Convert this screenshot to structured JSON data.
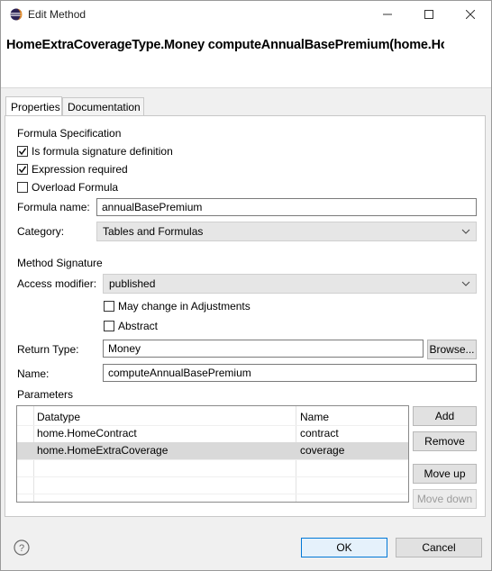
{
  "window": {
    "title": "Edit Method"
  },
  "banner": {
    "title": "HomeExtraCoverageType.Money computeAnnualBasePremium(home.HomeContract, home.HomeExtraCoverage)"
  },
  "tabs": [
    {
      "label": "Properties",
      "active": true
    },
    {
      "label": "Documentation",
      "active": false
    }
  ],
  "formula_spec": {
    "heading": "Formula Specification",
    "checkboxes": [
      {
        "label": "Is formula signature definition",
        "checked": true
      },
      {
        "label": "Expression required",
        "checked": true
      },
      {
        "label": "Overload Formula",
        "checked": false
      }
    ],
    "formula_name_label": "Formula name:",
    "formula_name_value": "annualBasePremium",
    "category_label": "Category:",
    "category_value": "Tables and Formulas"
  },
  "method_signature": {
    "heading": "Method Signature",
    "access_modifier_label": "Access modifier:",
    "access_modifier_value": "published",
    "checkboxes": [
      {
        "label": "May change in Adjustments",
        "checked": false
      },
      {
        "label": "Abstract",
        "checked": false
      }
    ],
    "return_type_label": "Return Type:",
    "return_type_value": "Money",
    "browse_label": "Browse...",
    "name_label": "Name:",
    "name_value": "computeAnnualBasePremium"
  },
  "parameters": {
    "heading": "Parameters",
    "columns": [
      "Datatype",
      "Name"
    ],
    "rows": [
      {
        "datatype": "home.HomeContract",
        "name": "contract",
        "selected": false
      },
      {
        "datatype": "home.HomeExtraCoverage",
        "name": "coverage",
        "selected": true
      }
    ],
    "buttons": {
      "add": "Add",
      "remove": "Remove",
      "move_up": "Move up",
      "move_down": "Move down"
    }
  },
  "footer": {
    "ok_label": "OK",
    "cancel_label": "Cancel",
    "help_icon": "help-icon"
  },
  "colors": {
    "accent": "#0078d7",
    "selection": "#d9d9d9",
    "panel": "#ffffff",
    "dialog": "#f0f0f0"
  }
}
